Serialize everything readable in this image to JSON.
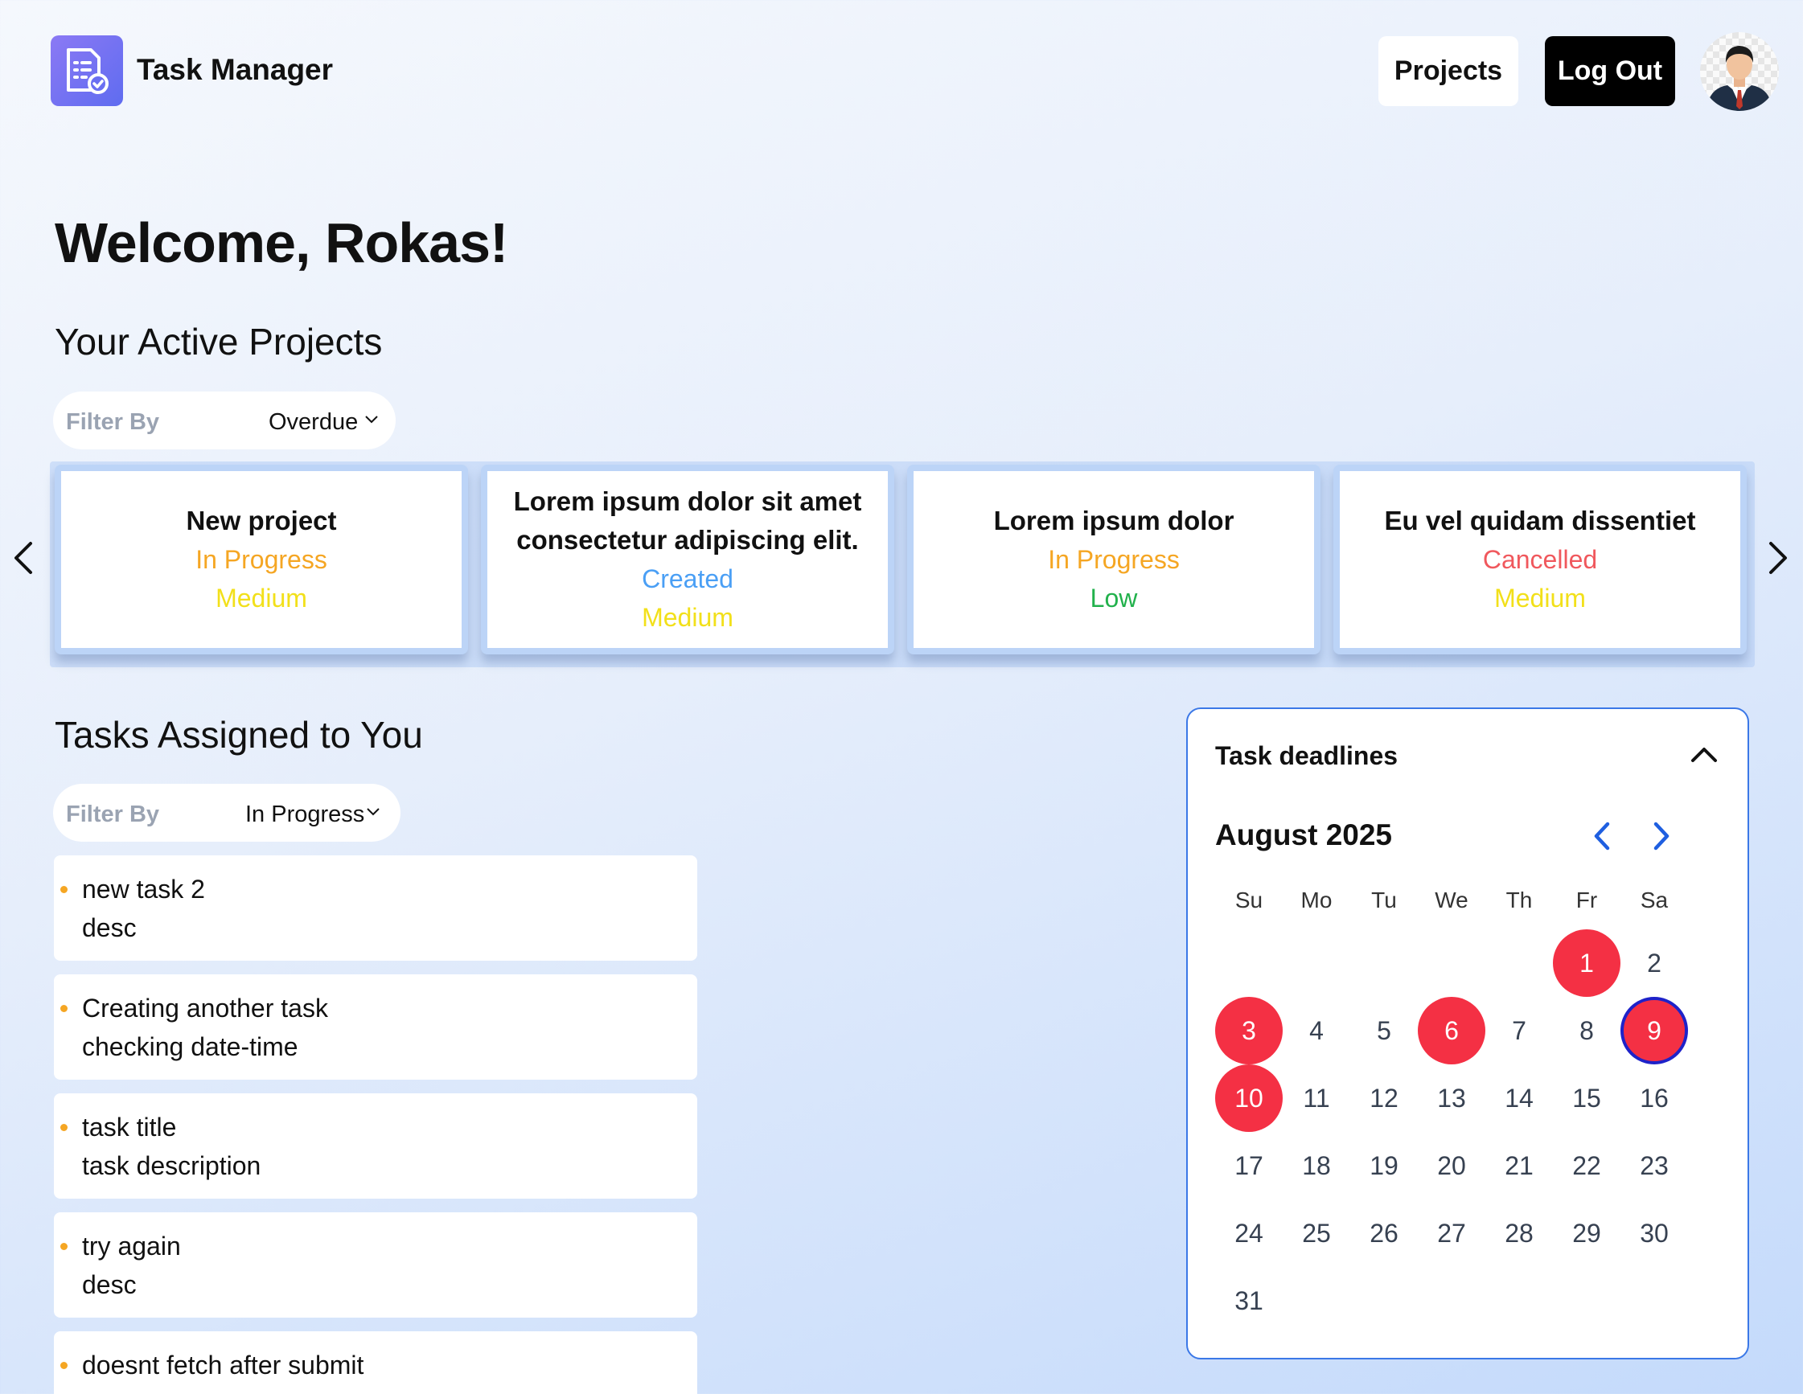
{
  "header": {
    "app_title": "Task Manager",
    "projects_label": "Projects",
    "logout_label": "Log Out"
  },
  "welcome": "Welcome, Rokas!",
  "active_projects": {
    "title": "Your Active Projects",
    "filter_label": "Filter By",
    "filter_value": "Overdue",
    "cards": [
      {
        "name": "New project",
        "status": "In Progress",
        "status_color": "#f5a623",
        "priority": "Medium",
        "priority_color": "#f2e01a"
      },
      {
        "name": "Lorem ipsum dolor sit amet consectetur adipiscing elit.",
        "status": "Created",
        "status_color": "#4a9ff5",
        "priority": "Medium",
        "priority_color": "#f2e01a"
      },
      {
        "name": "Lorem ipsum dolor",
        "status": "In Progress",
        "status_color": "#f5a623",
        "priority": "Low",
        "priority_color": "#22b14c"
      },
      {
        "name": "Eu vel quidam dissentiet",
        "status": "Cancelled",
        "status_color": "#f0585d",
        "priority": "Medium",
        "priority_color": "#f2e01a"
      }
    ]
  },
  "tasks": {
    "title": "Tasks Assigned to You",
    "filter_label": "Filter By",
    "filter_value": "In Progress",
    "items": [
      {
        "title": "new task 2",
        "desc": "desc"
      },
      {
        "title": "Creating another task",
        "desc": "checking date-time"
      },
      {
        "title": "task title",
        "desc": "task description"
      },
      {
        "title": "try again",
        "desc": "desc"
      },
      {
        "title": "doesnt fetch after submit",
        "desc": ""
      }
    ]
  },
  "calendar": {
    "title": "Task deadlines",
    "month": "August 2025",
    "weekdays": [
      "Su",
      "Mo",
      "Tu",
      "We",
      "Th",
      "Fr",
      "Sa"
    ],
    "first_weekday": 5,
    "days_in_month": 31,
    "deadline_days": [
      1,
      3,
      6,
      9,
      10
    ],
    "today": 9
  },
  "colors": {
    "accent": "#5f6cf0",
    "deadline": "#f43044",
    "calendar_border": "#3b78e7",
    "nav_arrow": "#1f5fe0"
  },
  "icons": {
    "logo": "document-check-icon",
    "carousel_prev": "chevron-left-icon",
    "carousel_next": "chevron-right-icon",
    "collapse": "chevron-up-icon"
  }
}
